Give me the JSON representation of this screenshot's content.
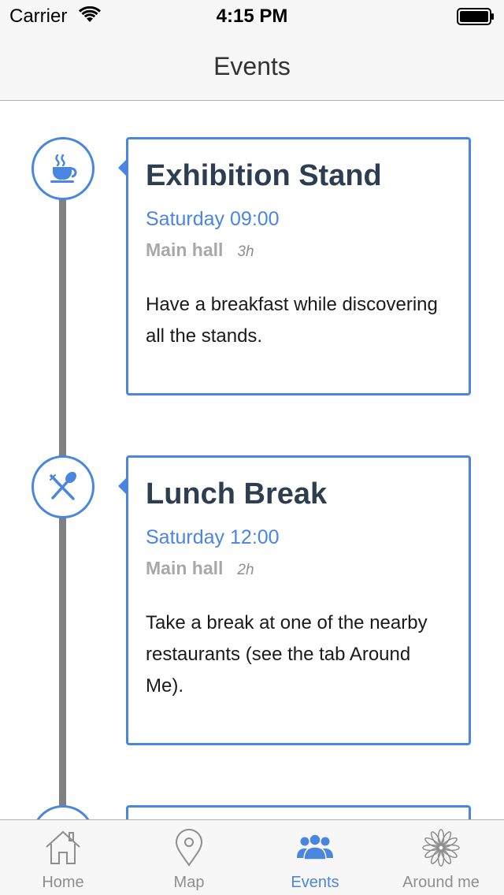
{
  "status_bar": {
    "carrier": "Carrier",
    "time": "4:15 PM"
  },
  "nav": {
    "title": "Events"
  },
  "events": [
    {
      "icon": "coffee-cup-icon",
      "title": "Exhibition Stand",
      "time": "Saturday 09:00",
      "location": "Main hall",
      "duration": "3h",
      "description": "Have a breakfast while discovering all the stands."
    },
    {
      "icon": "fork-spoon-icon",
      "title": "Lunch Break",
      "time": "Saturday 12:00",
      "location": "Main hall",
      "duration": "2h",
      "description": "Take a break at one of the nearby restaurants (see the tab Around Me)."
    }
  ],
  "tab_bar": {
    "tabs": [
      {
        "label": "Home",
        "icon": "house-icon",
        "active": false
      },
      {
        "label": "Map",
        "icon": "map-pin-icon",
        "active": false
      },
      {
        "label": "Events",
        "icon": "people-icon",
        "active": true
      },
      {
        "label": "Around me",
        "icon": "flower-icon",
        "active": false
      }
    ]
  },
  "colors": {
    "accent": "#4a86e0",
    "timeline": "#808080",
    "muted": "#a8a8a8",
    "bar_background": "#f7f7f7"
  }
}
